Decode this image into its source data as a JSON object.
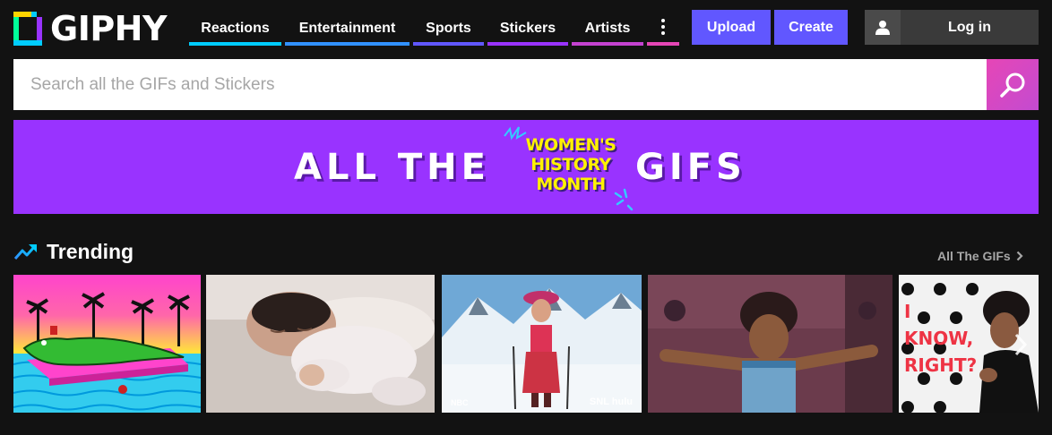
{
  "brand": {
    "name": "GIPHY"
  },
  "nav": {
    "items": [
      {
        "label": "Reactions",
        "color": "#00ccff"
      },
      {
        "label": "Entertainment",
        "color": "#3191ff"
      },
      {
        "label": "Sports",
        "color": "#6157ff"
      },
      {
        "label": "Stickers",
        "color": "#9933ff"
      },
      {
        "label": "Artists",
        "color": "#c442d1"
      }
    ],
    "more_color": "#e646b6"
  },
  "actions": {
    "upload": "Upload",
    "create": "Create",
    "login": "Log in"
  },
  "search": {
    "placeholder": "Search all the GIFs and Stickers"
  },
  "banner": {
    "left_text": "ALL THE",
    "badge_lines": [
      "WOMEN'S",
      "HISTORY",
      "MONTH"
    ],
    "right_text": "GIFS"
  },
  "trending": {
    "title": "Trending",
    "all_link": "All The GIFs",
    "gifs": [
      {
        "alt": "crocodile-pool-gif",
        "overlay": ""
      },
      {
        "alt": "sleeping-baby-gif",
        "overlay": ""
      },
      {
        "alt": "snl-ski-gif",
        "overlay_left": "NBC",
        "overlay_right": "SNL hulu"
      },
      {
        "alt": "cartoon-woman-gif",
        "overlay": ""
      },
      {
        "alt": "i-know-right-gif",
        "overlay": "I KNOW, RIGHT?"
      }
    ]
  },
  "colors": {
    "background": "#121212",
    "accent": "#6157ff",
    "banner": "#9933ff",
    "search_button": "#e646b6"
  }
}
